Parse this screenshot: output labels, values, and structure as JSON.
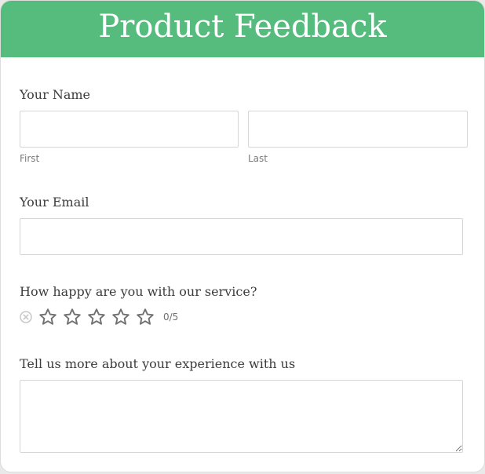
{
  "form": {
    "title": "Product Feedback",
    "name": {
      "label": "Your Name",
      "first_sublabel": "First",
      "last_sublabel": "Last",
      "first_value": "",
      "last_value": ""
    },
    "email": {
      "label": "Your Email",
      "value": ""
    },
    "rating": {
      "label": "How happy are you with our service?",
      "value": 0,
      "max": 5,
      "display": "0/5",
      "icon": "star-outline-icon",
      "clear_icon": "clear-icon"
    },
    "experience": {
      "label": "Tell us more about your experience with us",
      "value": ""
    }
  },
  "colors": {
    "header": "#55bc7e",
    "star_outline": "#707070",
    "label_text": "#3c3c3c"
  }
}
